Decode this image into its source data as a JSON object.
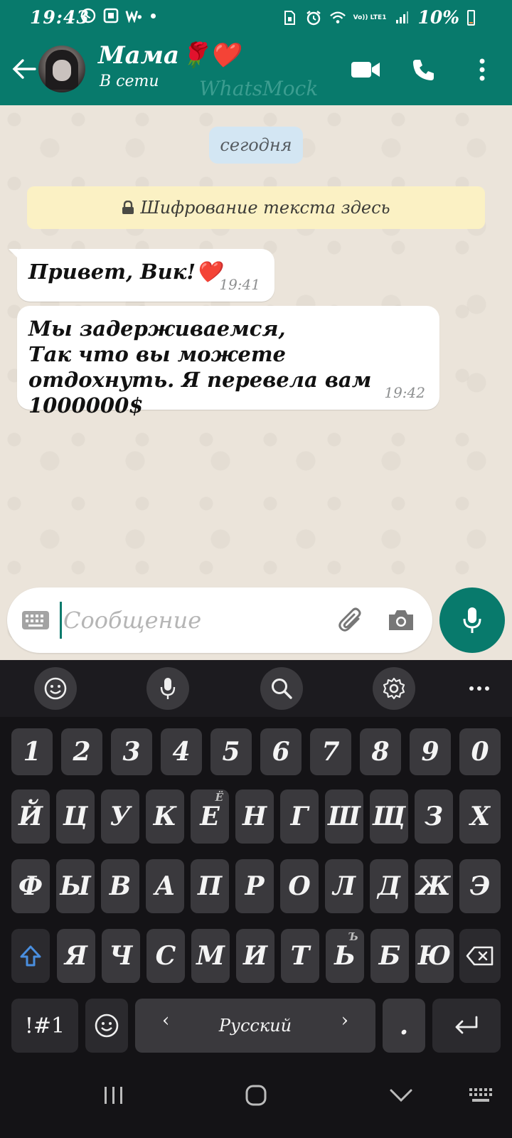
{
  "status_bar": {
    "time": "19:43",
    "volte": "Vo)) LTE1",
    "battery_percent": "10%",
    "battery_level": 0.1
  },
  "header": {
    "contact_name": "Мама🌹❤️",
    "status": "В сети",
    "watermark": "WhatsMock"
  },
  "chat": {
    "date_chip": "сегодня",
    "encryption_notice": "Шифрование текста здесь",
    "messages": [
      {
        "text": "Привет, Вик!❤️",
        "time": "19:41"
      },
      {
        "text": "Мы задерживаемся,\nТак что вы можете отдохнуть. Я перевела вам 1000000$",
        "time": "19:42"
      }
    ]
  },
  "composer": {
    "placeholder": "Сообщение"
  },
  "keyboard": {
    "rows": [
      [
        "1",
        "2",
        "3",
        "4",
        "5",
        "6",
        "7",
        "8",
        "9",
        "0"
      ],
      [
        "Й",
        "Ц",
        "У",
        "К",
        "Е",
        "Н",
        "Г",
        "Ш",
        "Щ",
        "З",
        "Х"
      ],
      [
        "Ф",
        "Ы",
        "В",
        "А",
        "П",
        "Р",
        "О",
        "Л",
        "Д",
        "Ж",
        "Э"
      ],
      [
        "Я",
        "Ч",
        "С",
        "М",
        "И",
        "Т",
        "Ь",
        "Б",
        "Ю"
      ]
    ],
    "hints": {
      "E": "Ё",
      "soft_sign": "Ъ"
    },
    "symbols_key": "!#1",
    "language": "Русский",
    "period_key": "."
  },
  "colors": {
    "brand_teal": "#087a6c",
    "chat_bg": "#ebe4da",
    "encryption_bg": "#fbf1c4",
    "date_chip_bg": "#d3e6f3",
    "keyboard_bg": "#141316",
    "key_bg": "#3a393d",
    "shift_active": "#4a8fe0"
  }
}
